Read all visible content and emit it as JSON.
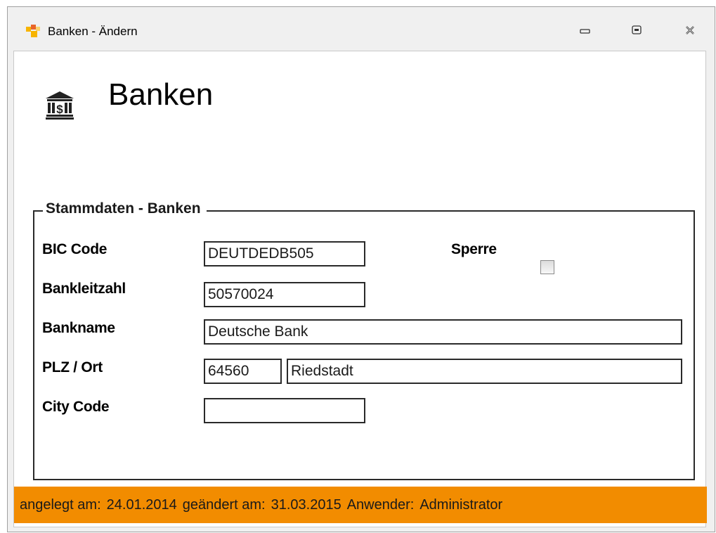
{
  "window": {
    "title": "Banken - Ändern",
    "buttons": {
      "minimize_icon": "minimize-icon",
      "maximize_icon": "maximize-icon",
      "close_icon": "close-icon"
    }
  },
  "header": {
    "icon": "bank-icon",
    "title": "Banken"
  },
  "group": {
    "legend": "Stammdaten - Banken",
    "fields": {
      "bic_label": "BIC Code",
      "bic_value": "DEUTDEDB505",
      "sperre_label": "Sperre",
      "sperre_checked": false,
      "blz_label": "Bankleitzahl",
      "blz_value": "50570024",
      "bankname_label": "Bankname",
      "bankname_value": "Deutsche Bank",
      "plz_ort_label": "PLZ / Ort",
      "plz_value": "64560",
      "ort_value": "Riedstadt",
      "city_code_label": "City Code",
      "city_code_value": ""
    }
  },
  "status": {
    "created_label": "angelegt am:",
    "created_value": "24.01.2014",
    "changed_label": "geändert am:",
    "changed_value": "31.03.2015",
    "user_label": "Anwender:",
    "user_value": "Administrator"
  },
  "colors": {
    "status_bar": "#f28c00",
    "app_icon_primary": "#f7b400",
    "app_icon_secondary": "#e8652a"
  }
}
